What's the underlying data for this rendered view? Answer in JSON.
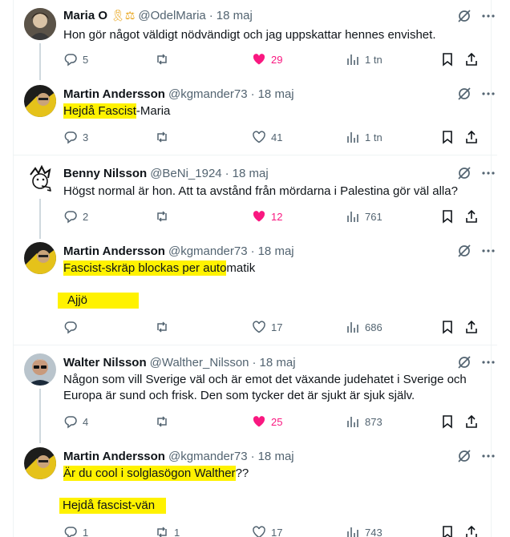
{
  "tweets": [
    {
      "name": "Maria O",
      "badges": "🎗⚖",
      "handle": "@OdelMaria",
      "date": "18 maj",
      "text": "Hon gör något väldigt nödvändigt och jag uppskattar hennes envishet.",
      "replies": "5",
      "retweets": "",
      "likes": "29",
      "views": "1 tn"
    },
    {
      "name": "Martin Andersson",
      "handle": "@kgmander73",
      "date": "18 maj",
      "text_hl": "Hejdå Fascist",
      "text_rest": "-Maria",
      "replies": "3",
      "retweets": "",
      "likes": "41",
      "views": "1 tn"
    },
    {
      "name": "Benny Nilsson",
      "handle": "@BeNi_1924",
      "date": "18 maj",
      "text": "Högst normal är hon. Att ta avstånd från mördarna i Palestina gör väl alla?",
      "replies": "2",
      "retweets": "",
      "likes": "12",
      "views": "761"
    },
    {
      "name": "Martin Andersson",
      "handle": "@kgmander73",
      "date": "18 maj",
      "text_hl": "Fascist-skräp blockas per auto",
      "text_rest": "matik",
      "text2": "Ajjö",
      "replies": "",
      "retweets": "",
      "likes": "17",
      "views": "686"
    },
    {
      "name": "Walter Nilsson",
      "handle": "@Walther_Nilsson",
      "date": "18 maj",
      "text_line1": "Någon som vill Sverige väl och är emot det växande judehatet i Sverige och",
      "text_line2": "Europa är sund och frisk. Den som tycker det är sjukt är sjuk själv.",
      "replies": "4",
      "retweets": "",
      "likes": "25",
      "views": "873"
    },
    {
      "name": "Martin Andersson",
      "handle": "@kgmander73",
      "date": "18 maj",
      "text_hl": "Är du cool i solglasögon Walther",
      "text_rest": "??",
      "text2": "Hejdå fascist-vän",
      "replies": "1",
      "retweets": "1",
      "likes": "17",
      "views": "743"
    }
  ],
  "colors": {
    "highlight": "#fff200",
    "like_active": "#f91880",
    "secondary": "#536471"
  }
}
